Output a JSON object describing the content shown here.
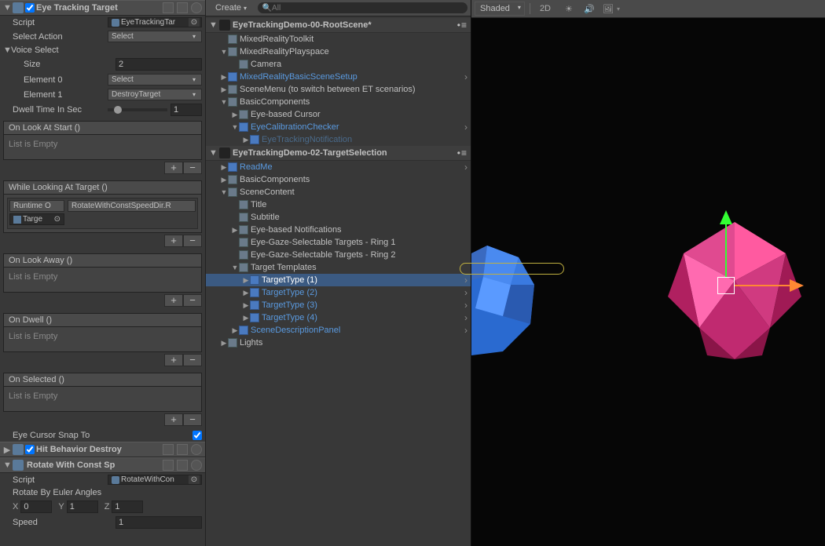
{
  "inspector": {
    "eyeTracking": {
      "title": "Eye Tracking Target",
      "checked": true,
      "scriptRow": {
        "label": "Script",
        "value": "EyeTrackingTar"
      },
      "selectAction": {
        "label": "Select Action",
        "value": "Select"
      },
      "voiceSelect": {
        "label": "Voice Select",
        "size": {
          "label": "Size",
          "value": "2"
        },
        "el0": {
          "label": "Element 0",
          "value": "Select"
        },
        "el1": {
          "label": "Element 1",
          "value": "DestroyTarget"
        }
      },
      "dwell": {
        "label": "Dwell Time In Sec",
        "value": "1"
      },
      "events": {
        "onLookStart": {
          "title": "On Look At Start ()",
          "empty": "List is Empty"
        },
        "whileLooking": {
          "title": "While Looking At Target ()",
          "runtime": "Runtime O",
          "method": "RotateWithConstSpeedDir.R",
          "obj": "Targe"
        },
        "onLookAway": {
          "title": "On Look Away ()",
          "empty": "List is Empty"
        },
        "onDwell": {
          "title": "On Dwell ()",
          "empty": "List is Empty"
        },
        "onSelected": {
          "title": "On Selected ()",
          "empty": "List is Empty"
        }
      },
      "snapTo": {
        "label": "Eye Cursor Snap To",
        "checked": true
      }
    },
    "hitBehavior": {
      "title": "Hit Behavior Destroy",
      "checked": true
    },
    "rotate": {
      "title": "Rotate With Const Sp",
      "scriptRow": {
        "label": "Script",
        "value": "RotateWithCon"
      },
      "eulerLabel": "Rotate By Euler Angles",
      "x": "0",
      "y": "1",
      "z": "1",
      "speed": {
        "label": "Speed",
        "value": "1"
      }
    }
  },
  "hierarchy": {
    "create": "Create",
    "searchPlaceholder": "All",
    "scenes": [
      {
        "name": "EyeTrackingDemo-00-RootScene*",
        "children": [
          {
            "name": "MixedRealityToolkit",
            "indent": 1,
            "fold": ""
          },
          {
            "name": "MixedRealityPlayspace",
            "indent": 1,
            "fold": "▼"
          },
          {
            "name": "Camera",
            "indent": 2,
            "fold": ""
          },
          {
            "name": "MixedRealityBasicSceneSetup",
            "indent": 1,
            "fold": "▶",
            "prefab": true,
            "go": true
          },
          {
            "name": "SceneMenu (to switch between ET scenarios)",
            "indent": 1,
            "fold": "▶"
          },
          {
            "name": "BasicComponents",
            "indent": 1,
            "fold": "▼"
          },
          {
            "name": "Eye-based Cursor",
            "indent": 2,
            "fold": "▶"
          },
          {
            "name": "EyeCalibrationChecker",
            "indent": 2,
            "fold": "▼",
            "prefab": true,
            "go": true
          },
          {
            "name": "EyeTrackingNotification",
            "indent": 3,
            "fold": "▶",
            "prefab": true,
            "dim": true
          }
        ]
      },
      {
        "name": "EyeTrackingDemo-02-TargetSelection",
        "children": [
          {
            "name": "ReadMe",
            "indent": 1,
            "fold": "▶",
            "prefab": true,
            "go": true
          },
          {
            "name": "BasicComponents",
            "indent": 1,
            "fold": "▶"
          },
          {
            "name": "SceneContent",
            "indent": 1,
            "fold": "▼"
          },
          {
            "name": "Title",
            "indent": 2,
            "fold": ""
          },
          {
            "name": "Subtitle",
            "indent": 2,
            "fold": ""
          },
          {
            "name": "Eye-based Notifications",
            "indent": 2,
            "fold": "▶"
          },
          {
            "name": "Eye-Gaze-Selectable Targets - Ring 1",
            "indent": 2,
            "fold": ""
          },
          {
            "name": "Eye-Gaze-Selectable Targets - Ring 2",
            "indent": 2,
            "fold": ""
          },
          {
            "name": "Target Templates",
            "indent": 2,
            "fold": "▼"
          },
          {
            "name": "TargetType (1)",
            "indent": 3,
            "fold": "▶",
            "prefab": true,
            "sel": true,
            "go": true
          },
          {
            "name": "TargetType (2)",
            "indent": 3,
            "fold": "▶",
            "prefab": true,
            "go": true
          },
          {
            "name": "TargetType (3)",
            "indent": 3,
            "fold": "▶",
            "prefab": true,
            "go": true
          },
          {
            "name": "TargetType (4)",
            "indent": 3,
            "fold": "▶",
            "prefab": true,
            "go": true
          },
          {
            "name": "SceneDescriptionPanel",
            "indent": 2,
            "fold": "▶",
            "prefab": true,
            "go": true
          },
          {
            "name": "Lights",
            "indent": 1,
            "fold": "▶"
          }
        ]
      }
    ]
  },
  "scene": {
    "shaded": "Shaded",
    "twoD": "2D"
  }
}
